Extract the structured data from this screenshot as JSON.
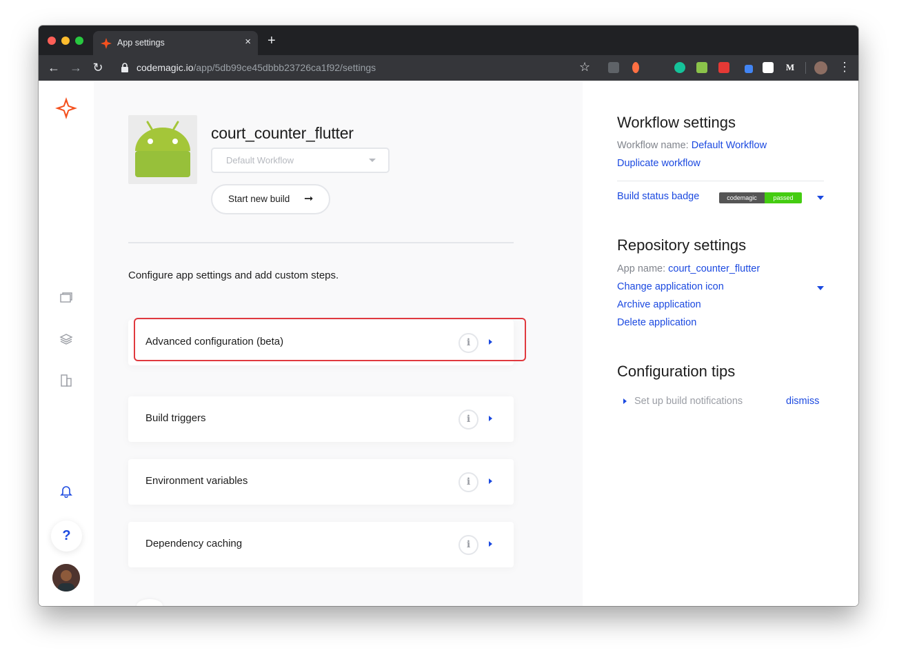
{
  "browser": {
    "tab_title": "App settings",
    "tab_close": "×",
    "new_tab": "+",
    "url_host": "codemagic.io",
    "url_path": "/app/5db99ce45dbbb23726ca1f92/settings",
    "back": "←",
    "forward": "→",
    "reload": "↻",
    "bookmark": "☆",
    "menu": "⋮"
  },
  "app": {
    "name": "court_counter_flutter",
    "workflow_select": "Default Workflow",
    "start_build_label": "Start new build",
    "start_build_arrow": "➞",
    "intro": "Configure app settings and add custom steps.",
    "cards": [
      {
        "title": "Advanced configuration (beta)",
        "info": "i"
      },
      {
        "title": "Build triggers",
        "info": "i"
      },
      {
        "title": "Environment variables",
        "info": "i"
      },
      {
        "title": "Dependency caching",
        "info": "i"
      }
    ]
  },
  "leftnav": {
    "help": "?"
  },
  "right_panel": {
    "workflow_settings": {
      "heading": "Workflow settings",
      "name_label": "Workflow name:",
      "name_value": "Default Workflow",
      "duplicate": "Duplicate workflow",
      "badge_label": "Build status badge",
      "badge_left": "codemagic",
      "badge_right": "passed"
    },
    "repository_settings": {
      "heading": "Repository settings",
      "app_name_label": "App name:",
      "app_name_value": "court_counter_flutter",
      "change_icon": "Change application icon",
      "archive": "Archive application",
      "delete": "Delete application"
    },
    "configuration_tips": {
      "heading": "Configuration tips",
      "tip": "Set up build notifications",
      "dismiss": "dismiss"
    }
  },
  "colors": {
    "accent": "#1b49e0",
    "highlight": "#e0393e",
    "badge_passed": "#44cc11"
  }
}
